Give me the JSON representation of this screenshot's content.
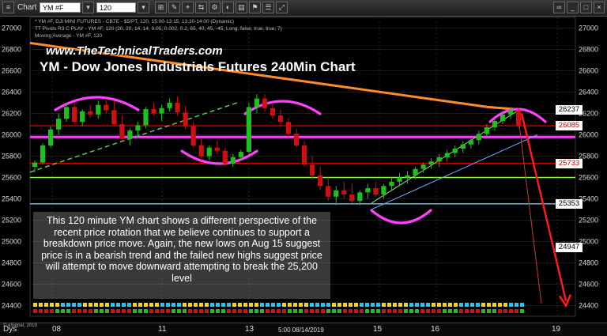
{
  "toolbar": {
    "chart_label": "Chart",
    "symbol": "YM #F",
    "interval": "120"
  },
  "legend": {
    "line1": "* YM #F, DJI MINI FUTURES - CBTE - $5/PT, 120, 15:00-13:15, 13:30-14:00 (Dynamic)",
    "line2": "TT Pivots R3 C PLAY - YM #F, 120 (20, 20, 14, 14, 0.05, 0.002, 0.2, 65, 40, 45, -45, Long, false, true, true, 7)",
    "line3": "Moving Average - YM #F, 120"
  },
  "headline": "www.TheTechnicalTraders.com",
  "title": "YM - Dow Jones Industrials Futures 240Min Chart",
  "annotation": "This 120 minute YM chart shows a different perspective of the recent price rotation that we believe continues to support a breakdown price move.  Again, the new lows on Aug 15 suggest price is in a bearish trend and the failed new highs suggest price will attempt to move downward attempting to break the 25,200 level",
  "price_tags": [
    {
      "label": "26237",
      "value": 26237,
      "bg": "#ffffff",
      "fg": "#000000"
    },
    {
      "label": "26085",
      "value": 26085,
      "bg": "#ffffff",
      "fg": "#d00000"
    },
    {
      "label": "25733",
      "value": 25733,
      "bg": "#ffffff",
      "fg": "#d00000"
    },
    {
      "label": "25353",
      "value": 25353,
      "bg": "#ffffff",
      "fg": "#000000"
    },
    {
      "label": "24947",
      "value": 24947,
      "bg": "#ffffff",
      "fg": "#000000"
    }
  ],
  "status": {
    "days_label": "Dys",
    "date_marker": "5:00 08/14/2019",
    "copyright": "© eSignal, 2019"
  },
  "colors": {
    "background": "#000000",
    "bull": "#1fbf1f",
    "bear": "#d01010",
    "ma": "#ff8c28",
    "pivot_magenta": "#ff40ff",
    "target_arrow": "#ff1a1a"
  },
  "chart_data": {
    "type": "line",
    "title": "YM - Dow Jones Industrials Futures 240Min Chart",
    "yticks": [
      27000,
      26800,
      26600,
      26400,
      26200,
      26000,
      25800,
      25600,
      25400,
      25200,
      25000,
      24800,
      24600,
      24400
    ],
    "ylim": [
      24300,
      27100
    ],
    "xticks": [
      "08",
      "11",
      "13",
      "15",
      "16",
      "19"
    ],
    "candles": [
      {
        "o": 25700,
        "h": 25760,
        "l": 25650,
        "c": 25740
      },
      {
        "o": 25740,
        "h": 25920,
        "l": 25720,
        "c": 25900
      },
      {
        "o": 25900,
        "h": 26080,
        "l": 25880,
        "c": 26050
      },
      {
        "o": 26050,
        "h": 26200,
        "l": 26000,
        "c": 26150
      },
      {
        "o": 26150,
        "h": 26290,
        "l": 26120,
        "c": 26260
      },
      {
        "o": 26260,
        "h": 26300,
        "l": 26100,
        "c": 26120
      },
      {
        "o": 26120,
        "h": 26240,
        "l": 26080,
        "c": 26220
      },
      {
        "o": 26220,
        "h": 26280,
        "l": 26160,
        "c": 26190
      },
      {
        "o": 26190,
        "h": 26320,
        "l": 26150,
        "c": 26280
      },
      {
        "o": 26280,
        "h": 26340,
        "l": 26200,
        "c": 26230
      },
      {
        "o": 26230,
        "h": 26320,
        "l": 26080,
        "c": 26100
      },
      {
        "o": 26100,
        "h": 26180,
        "l": 25940,
        "c": 25960
      },
      {
        "o": 25960,
        "h": 26060,
        "l": 25900,
        "c": 26040
      },
      {
        "o": 26040,
        "h": 26120,
        "l": 25980,
        "c": 26090
      },
      {
        "o": 26090,
        "h": 26260,
        "l": 26060,
        "c": 26240
      },
      {
        "o": 26240,
        "h": 26300,
        "l": 26180,
        "c": 26200
      },
      {
        "o": 26200,
        "h": 26280,
        "l": 26130,
        "c": 26250
      },
      {
        "o": 26250,
        "h": 26340,
        "l": 26220,
        "c": 26300
      },
      {
        "o": 26300,
        "h": 26360,
        "l": 26180,
        "c": 26210
      },
      {
        "o": 26210,
        "h": 26270,
        "l": 26050,
        "c": 26080
      },
      {
        "o": 26080,
        "h": 26120,
        "l": 25880,
        "c": 25900
      },
      {
        "o": 25900,
        "h": 25960,
        "l": 25760,
        "c": 25800
      },
      {
        "o": 25800,
        "h": 25900,
        "l": 25760,
        "c": 25880
      },
      {
        "o": 25880,
        "h": 25940,
        "l": 25820,
        "c": 25850
      },
      {
        "o": 25850,
        "h": 25880,
        "l": 25700,
        "c": 25730
      },
      {
        "o": 25730,
        "h": 25820,
        "l": 25700,
        "c": 25790
      },
      {
        "o": 25790,
        "h": 25860,
        "l": 25760,
        "c": 25840
      },
      {
        "o": 25840,
        "h": 26300,
        "l": 25820,
        "c": 26260
      },
      {
        "o": 26260,
        "h": 26380,
        "l": 26200,
        "c": 26340
      },
      {
        "o": 26340,
        "h": 26380,
        "l": 26220,
        "c": 26250
      },
      {
        "o": 26250,
        "h": 26300,
        "l": 26150,
        "c": 26180
      },
      {
        "o": 26180,
        "h": 26240,
        "l": 26080,
        "c": 26120
      },
      {
        "o": 26120,
        "h": 26160,
        "l": 25980,
        "c": 26010
      },
      {
        "o": 26010,
        "h": 26060,
        "l": 25880,
        "c": 25900
      },
      {
        "o": 25900,
        "h": 25940,
        "l": 25700,
        "c": 25720
      },
      {
        "o": 25720,
        "h": 25800,
        "l": 25580,
        "c": 25620
      },
      {
        "o": 25620,
        "h": 25700,
        "l": 25480,
        "c": 25520
      },
      {
        "o": 25520,
        "h": 25600,
        "l": 25380,
        "c": 25420
      },
      {
        "o": 25420,
        "h": 25520,
        "l": 25340,
        "c": 25480
      },
      {
        "o": 25480,
        "h": 25560,
        "l": 25400,
        "c": 25440
      },
      {
        "o": 25440,
        "h": 25540,
        "l": 25360,
        "c": 25380
      },
      {
        "o": 25380,
        "h": 25480,
        "l": 25340,
        "c": 25460
      },
      {
        "o": 25460,
        "h": 25540,
        "l": 25400,
        "c": 25500
      },
      {
        "o": 25500,
        "h": 25560,
        "l": 25420,
        "c": 25440
      },
      {
        "o": 25440,
        "h": 25540,
        "l": 25400,
        "c": 25520
      },
      {
        "o": 25520,
        "h": 25600,
        "l": 25480,
        "c": 25560
      },
      {
        "o": 25560,
        "h": 25640,
        "l": 25520,
        "c": 25600
      },
      {
        "o": 25600,
        "h": 25660,
        "l": 25540,
        "c": 25620
      },
      {
        "o": 25620,
        "h": 25700,
        "l": 25580,
        "c": 25680
      },
      {
        "o": 25680,
        "h": 25740,
        "l": 25640,
        "c": 25720
      },
      {
        "o": 25720,
        "h": 25780,
        "l": 25680,
        "c": 25750
      },
      {
        "o": 25750,
        "h": 25820,
        "l": 25700,
        "c": 25790
      },
      {
        "o": 25790,
        "h": 25860,
        "l": 25750,
        "c": 25830
      },
      {
        "o": 25830,
        "h": 25900,
        "l": 25790,
        "c": 25870
      },
      {
        "o": 25870,
        "h": 25940,
        "l": 25830,
        "c": 25910
      },
      {
        "o": 25910,
        "h": 25980,
        "l": 25870,
        "c": 25950
      },
      {
        "o": 25950,
        "h": 26040,
        "l": 25910,
        "c": 26010
      },
      {
        "o": 26010,
        "h": 26100,
        "l": 25980,
        "c": 26070
      },
      {
        "o": 26070,
        "h": 26160,
        "l": 26040,
        "c": 26130
      },
      {
        "o": 26130,
        "h": 26220,
        "l": 26100,
        "c": 26190
      },
      {
        "o": 26190,
        "h": 26260,
        "l": 26150,
        "c": 26230
      },
      {
        "o": 26230,
        "h": 26250,
        "l": 26060,
        "c": 26085
      }
    ],
    "moving_average": [
      26860,
      26820,
      26780,
      26740,
      26700,
      26660,
      26620,
      26580,
      26540,
      26500,
      26460,
      26420,
      26380,
      26340,
      26300,
      26260,
      26237
    ],
    "horizontal_levels": [
      {
        "value": 25980,
        "color": "#ff40ff"
      },
      {
        "value": 26085,
        "color": "#d00000"
      },
      {
        "value": 25733,
        "color": "#d00000"
      },
      {
        "value": 25600,
        "color": "#7cff3c"
      },
      {
        "value": 25353,
        "color": "#5fd0ff"
      }
    ],
    "projection_target": 24400
  }
}
